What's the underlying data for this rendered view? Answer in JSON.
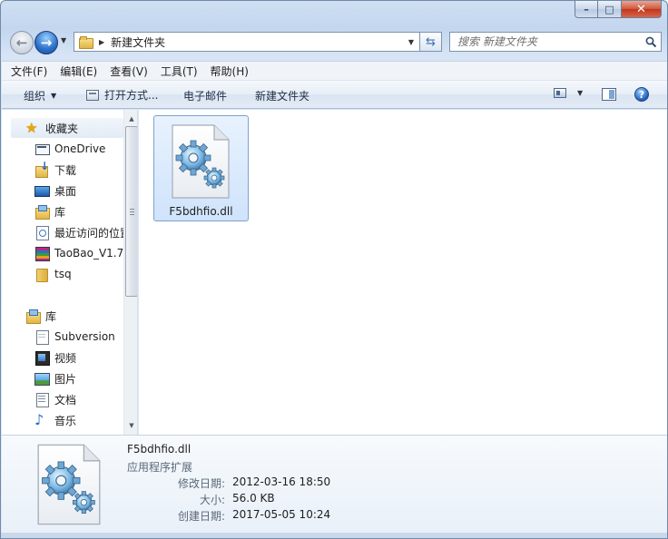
{
  "window": {
    "controls": {
      "minimize": "–",
      "maximize": "□",
      "close": "✕"
    }
  },
  "address_bar": {
    "crumbs": [
      "新建文件夹"
    ]
  },
  "search": {
    "placeholder": "搜索 新建文件夹"
  },
  "menu": {
    "items": [
      "文件(F)",
      "编辑(E)",
      "查看(V)",
      "工具(T)",
      "帮助(H)"
    ]
  },
  "toolbar": {
    "organize": "组织",
    "open_with": "打开方式...",
    "email": "电子邮件",
    "new_folder": "新建文件夹",
    "help": "?"
  },
  "nav": {
    "favorites_label": "收藏夹",
    "favorites": [
      {
        "label": "OneDrive",
        "icon": "onedrive-icon"
      },
      {
        "label": "下载",
        "icon": "downloads-icon"
      },
      {
        "label": "桌面",
        "icon": "desktop-icon"
      },
      {
        "label": "库",
        "icon": "library-icon"
      },
      {
        "label": "最近访问的位置",
        "icon": "recent-places-icon"
      },
      {
        "label": "TaoBao_V1.7",
        "icon": "archive-icon"
      },
      {
        "label": "tsq",
        "icon": "folder-icon"
      }
    ],
    "libraries_label": "库",
    "libraries": [
      {
        "label": "Subversion",
        "icon": "document-library-icon"
      },
      {
        "label": "视频",
        "icon": "video-icon"
      },
      {
        "label": "图片",
        "icon": "picture-icon"
      },
      {
        "label": "文档",
        "icon": "documents-icon"
      },
      {
        "label": "音乐",
        "icon": "music-icon"
      }
    ]
  },
  "files": [
    {
      "name": "F5bdhfio.dll",
      "icon": "dll-gear-file-icon",
      "selected": true
    }
  ],
  "details": {
    "name": "F5bdhfio.dll",
    "type": "应用程序扩展",
    "fields": [
      {
        "key": "修改日期:",
        "value": "2012-03-16 18:50"
      },
      {
        "key": "大小:",
        "value": "56.0 KB"
      },
      {
        "key": "创建日期:",
        "value": "2017-05-05 10:24"
      }
    ]
  }
}
